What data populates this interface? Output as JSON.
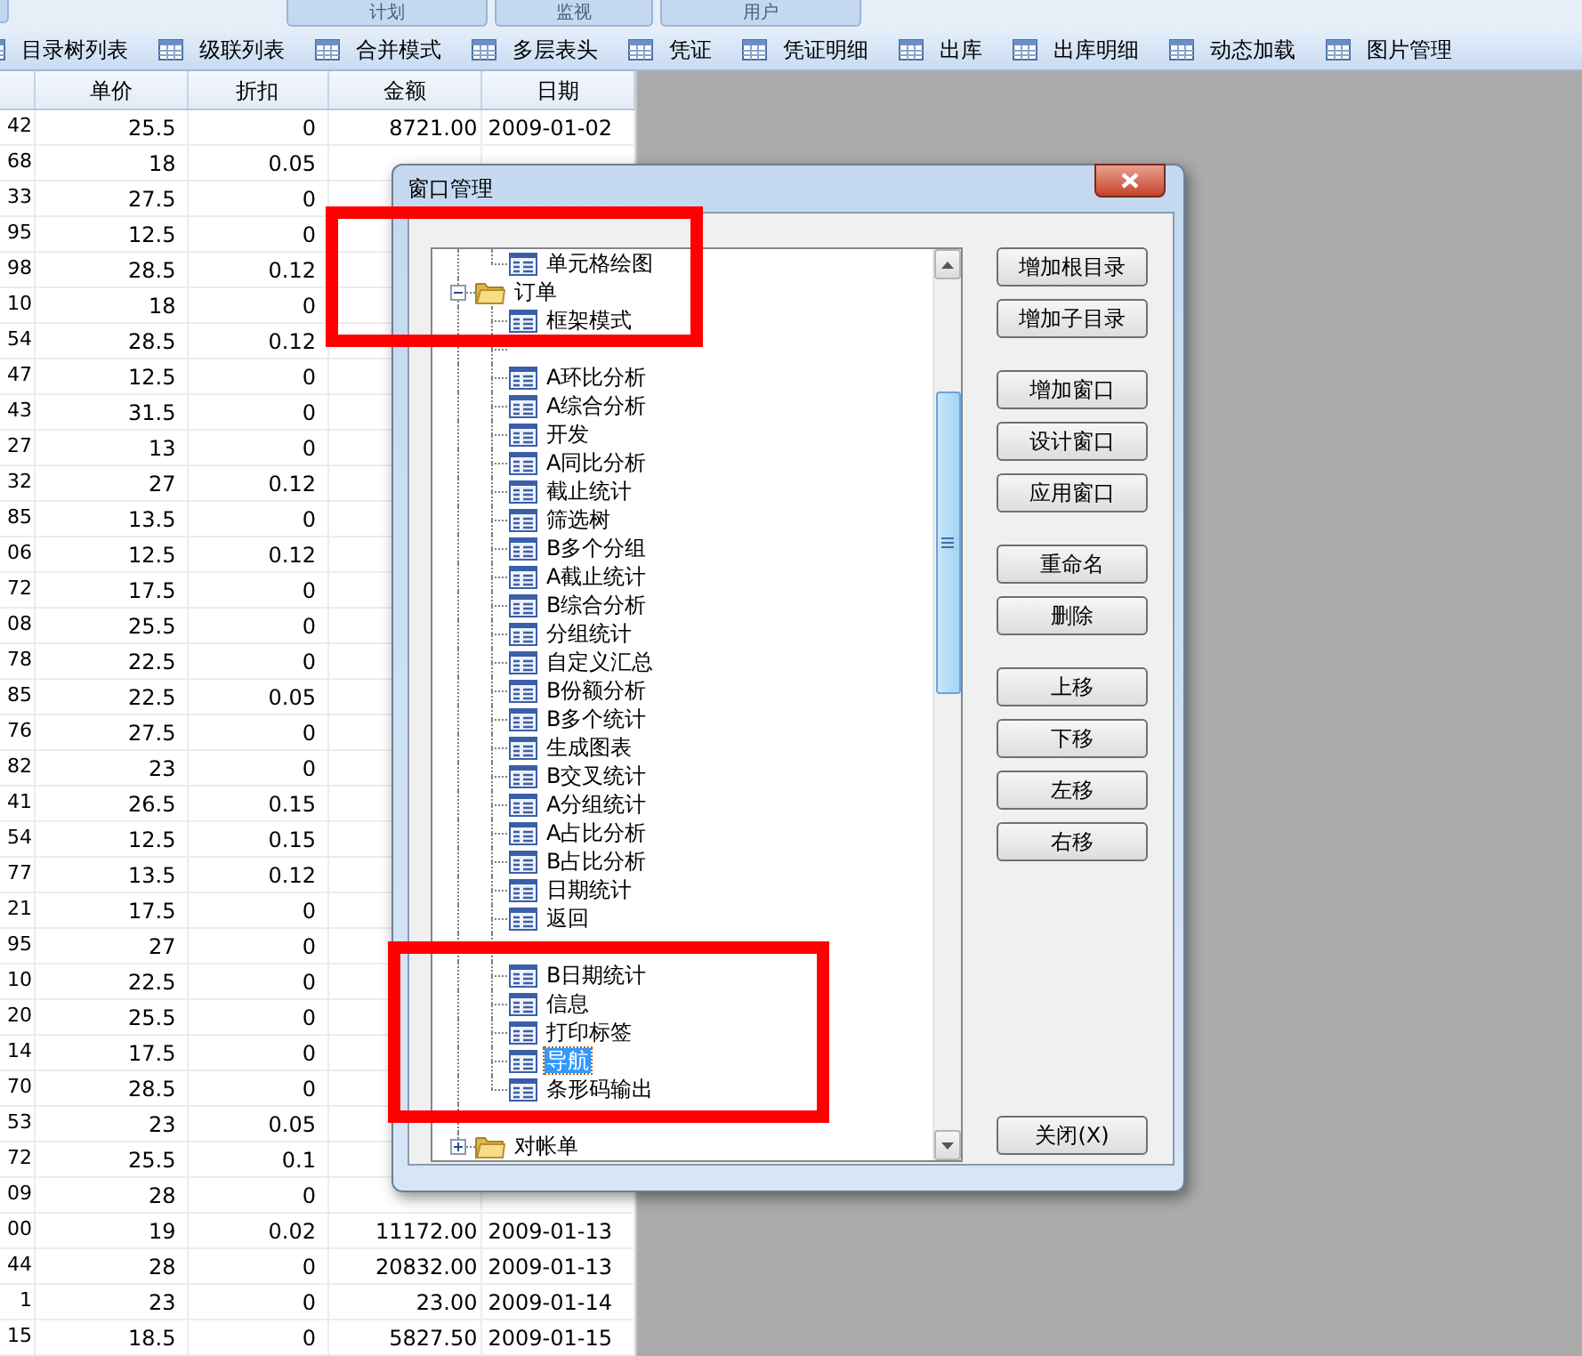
{
  "top_tabs": [
    {
      "label": "计划"
    },
    {
      "label": "监视"
    },
    {
      "label": "用户"
    }
  ],
  "toolbar": [
    {
      "label": "目录树列表"
    },
    {
      "label": "级联列表"
    },
    {
      "label": "合并模式"
    },
    {
      "label": "多层表头"
    },
    {
      "label": "凭证"
    },
    {
      "label": "凭证明细"
    },
    {
      "label": "出库"
    },
    {
      "label": "出库明细"
    },
    {
      "label": "动态加载"
    },
    {
      "label": "图片管理"
    }
  ],
  "table": {
    "columns": [
      "单价",
      "折扣",
      "金额",
      "日期"
    ],
    "rows": [
      {
        "column_1": "42",
        "unit_price": "25.5",
        "discount": "0",
        "amount": "8721.00",
        "date": "2009-01-02"
      },
      {
        "column_1": "68",
        "unit_price": "18",
        "discount": "0.05"
      },
      {
        "column_1": "33",
        "unit_price": "27.5",
        "discount": "0"
      },
      {
        "column_1": "95",
        "unit_price": "12.5",
        "discount": "0"
      },
      {
        "column_1": "98",
        "unit_price": "28.5",
        "discount": "0.12"
      },
      {
        "column_1": "10",
        "unit_price": "18",
        "discount": "0"
      },
      {
        "column_1": "54",
        "unit_price": "28.5",
        "discount": "0.12"
      },
      {
        "column_1": "47",
        "unit_price": "12.5",
        "discount": "0"
      },
      {
        "column_1": "43",
        "unit_price": "31.5",
        "discount": "0"
      },
      {
        "column_1": "27",
        "unit_price": "13",
        "discount": "0"
      },
      {
        "column_1": "32",
        "unit_price": "27",
        "discount": "0.12"
      },
      {
        "column_1": "85",
        "unit_price": "13.5",
        "discount": "0"
      },
      {
        "column_1": "06",
        "unit_price": "12.5",
        "discount": "0.12"
      },
      {
        "column_1": "72",
        "unit_price": "17.5",
        "discount": "0"
      },
      {
        "column_1": "08",
        "unit_price": "25.5",
        "discount": "0"
      },
      {
        "column_1": "78",
        "unit_price": "22.5",
        "discount": "0"
      },
      {
        "column_1": "85",
        "unit_price": "22.5",
        "discount": "0.05"
      },
      {
        "column_1": "76",
        "unit_price": "27.5",
        "discount": "0"
      },
      {
        "column_1": "82",
        "unit_price": "23",
        "discount": "0"
      },
      {
        "column_1": "41",
        "unit_price": "26.5",
        "discount": "0.15"
      },
      {
        "column_1": "54",
        "unit_price": "12.5",
        "discount": "0.15"
      },
      {
        "column_1": "77",
        "unit_price": "13.5",
        "discount": "0.12"
      },
      {
        "column_1": "21",
        "unit_price": "17.5",
        "discount": "0"
      },
      {
        "column_1": "95",
        "unit_price": "27",
        "discount": "0"
      },
      {
        "column_1": "10",
        "unit_price": "22.5",
        "discount": "0"
      },
      {
        "column_1": "20",
        "unit_price": "25.5",
        "discount": "0"
      },
      {
        "column_1": "14",
        "unit_price": "17.5",
        "discount": "0"
      },
      {
        "column_1": "70",
        "unit_price": "28.5",
        "discount": "0"
      },
      {
        "column_1": "53",
        "unit_price": "23",
        "discount": "0.05"
      },
      {
        "column_1": "72",
        "unit_price": "25.5",
        "discount": "0.1"
      },
      {
        "column_1": "09",
        "unit_price": "28",
        "discount": "0"
      },
      {
        "column_1": "00",
        "unit_price": "19",
        "discount": "0.02",
        "amount": "11172.00",
        "date": "2009-01-13"
      },
      {
        "column_1": "44",
        "unit_price": "28",
        "discount": "0",
        "amount": "20832.00",
        "date": "2009-01-13"
      },
      {
        "column_1": "1",
        "unit_price": "23",
        "discount": "0",
        "amount": "23.00",
        "date": "2009-01-14"
      },
      {
        "column_1": "15",
        "unit_price": "18.5",
        "discount": "0",
        "amount": "5827.50",
        "date": "2009-01-15"
      }
    ]
  },
  "dialog": {
    "title": "窗口管理",
    "tree": [
      {
        "kind": "folder",
        "children": [
          {
            "kind": "leaf",
            "label": "单元格绘图",
            "selected": false
          }
        ]
      },
      {
        "kind": "folder",
        "label": "订单",
        "expanded": true,
        "selected": false,
        "children": [
          {
            "kind": "leaf",
            "label": "框架模式",
            "selected": false
          },
          {
            "kind": "covered"
          },
          {
            "kind": "leaf",
            "label": "A环比分析",
            "selected": false
          },
          {
            "kind": "leaf",
            "label": "A综合分析",
            "selected": false
          },
          {
            "kind": "leaf",
            "label": "开发",
            "selected": false
          },
          {
            "kind": "leaf",
            "label": "A同比分析",
            "selected": false
          },
          {
            "kind": "leaf",
            "label": "截止统计",
            "selected": false
          },
          {
            "kind": "leaf",
            "label": "筛选树",
            "selected": false
          },
          {
            "kind": "leaf",
            "label": "B多个分组",
            "selected": false
          },
          {
            "kind": "leaf",
            "label": "A截止统计",
            "selected": false
          },
          {
            "kind": "leaf",
            "label": "B综合分析",
            "selected": false
          },
          {
            "kind": "leaf",
            "label": "分组统计",
            "selected": false
          },
          {
            "kind": "leaf",
            "label": "自定义汇总",
            "selected": false
          },
          {
            "kind": "leaf",
            "label": "B份额分析",
            "selected": false
          },
          {
            "kind": "leaf",
            "label": "B多个统计",
            "selected": false
          },
          {
            "kind": "leaf",
            "label": "生成图表",
            "selected": false
          },
          {
            "kind": "leaf",
            "label": "B交叉统计",
            "selected": false
          },
          {
            "kind": "leaf",
            "label": "A分组统计",
            "selected": false
          },
          {
            "kind": "leaf",
            "label": "A占比分析",
            "selected": false
          },
          {
            "kind": "leaf",
            "label": "B占比分析",
            "selected": false
          },
          {
            "kind": "leaf",
            "label": "日期统计",
            "selected": false
          },
          {
            "kind": "leaf",
            "label": "返回",
            "selected": false
          },
          {
            "kind": "covered"
          },
          {
            "kind": "leaf",
            "label": "B日期统计",
            "selected": false
          },
          {
            "kind": "leaf",
            "label": "信息",
            "selected": false
          },
          {
            "kind": "leaf",
            "label": "打印标签",
            "selected": false
          },
          {
            "kind": "leaf",
            "label": "导航",
            "selected": true
          },
          {
            "kind": "leaf",
            "label": "条形码输出",
            "selected": false
          }
        ]
      },
      {
        "kind": "covered"
      },
      {
        "kind": "folder",
        "label": "对帐单",
        "expanded": false,
        "selected": false
      }
    ],
    "button_groups": [
      [
        "增加根目录",
        "增加子目录"
      ],
      [
        "增加窗口",
        "设计窗口",
        "应用窗口"
      ],
      [
        "重命名",
        "删除"
      ],
      [
        "上移",
        "下移",
        "左移",
        "右移"
      ]
    ],
    "close_button": "关闭(X)"
  }
}
